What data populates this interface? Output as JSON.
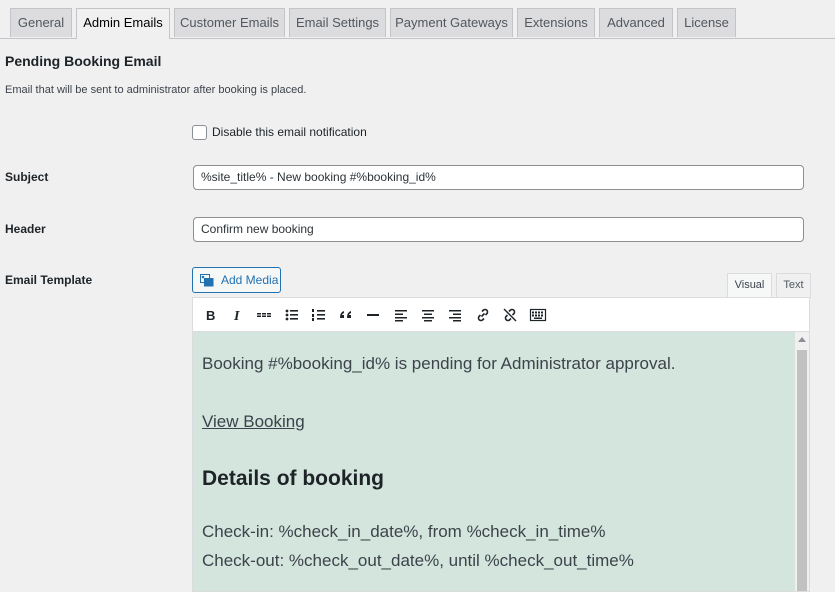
{
  "tabs": [
    {
      "label": "General",
      "active": false
    },
    {
      "label": "Admin Emails",
      "active": true
    },
    {
      "label": "Customer Emails",
      "active": false
    },
    {
      "label": "Email Settings",
      "active": false
    },
    {
      "label": "Payment Gateways",
      "active": false
    },
    {
      "label": "Extensions",
      "active": false
    },
    {
      "label": "Advanced",
      "active": false
    },
    {
      "label": "License",
      "active": false
    }
  ],
  "section": {
    "title": "Pending Booking Email",
    "description": "Email that will be sent to administrator after booking is placed."
  },
  "disable_notification": {
    "label": "Disable this email notification",
    "checked": false
  },
  "subject": {
    "label": "Subject",
    "value": "%site_title% - New booking #%booking_id%"
  },
  "header": {
    "label": "Header",
    "value": "Confirm new booking"
  },
  "email_template": {
    "label": "Email Template",
    "add_media_label": "Add Media",
    "mode_tabs": [
      "Visual",
      "Text"
    ],
    "active_mode": "Visual",
    "toolbar": [
      "bold-icon",
      "italic-icon",
      "strikethrough-icon",
      "bullet-list-icon",
      "numbered-list-icon",
      "blockquote-icon",
      "horizontal-line-icon",
      "align-left-icon",
      "align-center-icon",
      "align-right-icon",
      "insert-link-icon",
      "remove-link-icon",
      "toolbar-toggle-icon"
    ],
    "content": {
      "line1": "Booking #%booking_id% is pending for Administrator approval.",
      "link": "View Booking",
      "heading": "Details of booking",
      "checkin": "Check-in: %check_in_date%, from %check_in_time%",
      "checkout": "Check-out: %check_out_date%, until %check_out_time%"
    },
    "editor_bg": "#d4e5dd"
  }
}
